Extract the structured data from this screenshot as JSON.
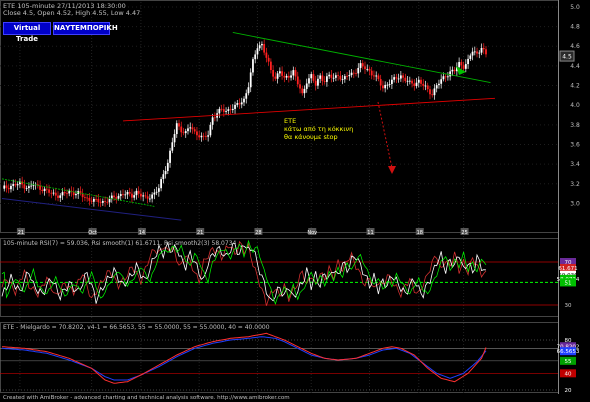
{
  "header": {
    "line1": "ETE  105-minute  27/11/2013 18:30:00",
    "line2": "Close 4.5, Open 4.52, High 4.55, Low 4.47"
  },
  "buttons": {
    "virtual_trade": "Virtual Trade",
    "broker": "ΝΑΥΤΕΜΠΟΡΙΚΗ"
  },
  "annotation": [
    "ETE",
    "κάτω από τη κόκκινη",
    "θα κάνουμε stop"
  ],
  "footer": "Created with AmiBroker - advanced charting and technical analysis software. http://www.amibroker.com",
  "colors": {
    "background": "#000000",
    "up_candle": "#ffffff",
    "down_candle": "#ff2020",
    "green_trend": "#00b000",
    "red_trend": "#e00000",
    "blue_trend": "#202080",
    "rsi": "#ffffff",
    "rsi_smooth": "#d03030",
    "rsi_smooth2": "#00ff00",
    "mg_line": "#ff3030",
    "mg_line2": "#2040ff",
    "annotation": "#ffff00"
  },
  "chart_data": [
    {
      "type": "candlestick",
      "title": "ETE 105-minute",
      "y_ticks": [
        5.0,
        4.8,
        4.6,
        4.4,
        4.2,
        4.0,
        3.8,
        3.6,
        3.4,
        3.2,
        3.0
      ],
      "ylim": [
        2.75,
        5.03
      ],
      "last_value": "4.5",
      "x_ticks": [
        "21",
        "Oct",
        "14",
        "21",
        "28",
        "Nov",
        "11",
        "18",
        "25"
      ],
      "close_path": [
        [
          0,
          3.15
        ],
        [
          4,
          3.18
        ],
        [
          8,
          3.2
        ],
        [
          12,
          3.16
        ],
        [
          14,
          3.19
        ],
        [
          18,
          3.15
        ],
        [
          22,
          3.1
        ],
        [
          26,
          3.08
        ],
        [
          30,
          3.12
        ],
        [
          34,
          3.1
        ],
        [
          38,
          3.05
        ],
        [
          42,
          3.02
        ],
        [
          46,
          3.02
        ],
        [
          50,
          3.06
        ],
        [
          54,
          3.1
        ],
        [
          58,
          3.08
        ],
        [
          60,
          3.12
        ],
        [
          62,
          3.08
        ],
        [
          64,
          3.05
        ],
        [
          68,
          3.1
        ],
        [
          70,
          3.15
        ],
        [
          72,
          3.3
        ],
        [
          74,
          3.42
        ],
        [
          76,
          3.62
        ],
        [
          78,
          3.8
        ],
        [
          80,
          3.75
        ],
        [
          82,
          3.72
        ],
        [
          84,
          3.78
        ],
        [
          86,
          3.72
        ],
        [
          88,
          3.7
        ],
        [
          90,
          3.66
        ],
        [
          92,
          3.7
        ],
        [
          94,
          3.88
        ],
        [
          96,
          3.92
        ],
        [
          98,
          3.95
        ],
        [
          100,
          3.94
        ],
        [
          102,
          3.97
        ],
        [
          104,
          3.98
        ],
        [
          106,
          4.02
        ],
        [
          108,
          4.06
        ],
        [
          110,
          4.2
        ],
        [
          112,
          4.44
        ],
        [
          114,
          4.6
        ],
        [
          116,
          4.62
        ],
        [
          118,
          4.48
        ],
        [
          120,
          4.35
        ],
        [
          122,
          4.28
        ],
        [
          124,
          4.35
        ],
        [
          126,
          4.26
        ],
        [
          128,
          4.3
        ],
        [
          130,
          4.35
        ],
        [
          132,
          4.22
        ],
        [
          134,
          4.1
        ],
        [
          136,
          4.25
        ],
        [
          138,
          4.3
        ],
        [
          140,
          4.2
        ],
        [
          142,
          4.3
        ],
        [
          144,
          4.25
        ],
        [
          146,
          4.3
        ],
        [
          148,
          4.27
        ],
        [
          150,
          4.32
        ],
        [
          152,
          4.25
        ],
        [
          154,
          4.3
        ],
        [
          156,
          4.32
        ],
        [
          158,
          4.35
        ],
        [
          160,
          4.4
        ],
        [
          162,
          4.38
        ],
        [
          164,
          4.35
        ],
        [
          166,
          4.3
        ],
        [
          168,
          4.25
        ],
        [
          170,
          4.18
        ],
        [
          172,
          4.22
        ],
        [
          174,
          4.24
        ],
        [
          176,
          4.28
        ],
        [
          178,
          4.3
        ],
        [
          180,
          4.26
        ],
        [
          182,
          4.22
        ],
        [
          184,
          4.22
        ],
        [
          186,
          4.25
        ],
        [
          188,
          4.2
        ],
        [
          190,
          4.15
        ],
        [
          192,
          4.12
        ],
        [
          194,
          4.2
        ],
        [
          196,
          4.25
        ],
        [
          198,
          4.3
        ],
        [
          200,
          4.34
        ],
        [
          202,
          4.35
        ],
        [
          204,
          4.42
        ],
        [
          206,
          4.4
        ],
        [
          208,
          4.45
        ],
        [
          210,
          4.55
        ],
        [
          212,
          4.52
        ],
        [
          214,
          4.6
        ],
        [
          216,
          4.5
        ]
      ],
      "trendlines": [
        {
          "color": "green",
          "from": [
            103,
            4.74
          ],
          "to": [
            218,
            4.23
          ]
        },
        {
          "color": "red",
          "from": [
            54,
            3.84
          ],
          "to": [
            220,
            4.07
          ]
        },
        {
          "color": "green",
          "from": [
            0,
            3.25
          ],
          "to": [
            68,
            2.97
          ]
        },
        {
          "color": "blue",
          "from": [
            0,
            3.05
          ],
          "to": [
            80,
            2.83
          ]
        }
      ]
    },
    {
      "type": "line",
      "title": "105-minute RSI(7) = 59.036, Rsi smooth(1) 61.6711, Rsi smooth2(3) 58.0734",
      "y_ticks": [
        70,
        51,
        30
      ],
      "right_labels": [
        "70",
        "61.671",
        "59.036",
        "58.0734",
        "51",
        "30"
      ],
      "series": [
        {
          "name": "RSI(7)",
          "last": 59.036
        },
        {
          "name": "Rsi smooth(1)",
          "last": 61.6711
        },
        {
          "name": "Rsi smooth2(3)",
          "last": 58.0734
        }
      ],
      "rsi_path": [
        [
          0,
          38
        ],
        [
          4,
          55
        ],
        [
          8,
          42
        ],
        [
          12,
          62
        ],
        [
          14,
          48
        ],
        [
          18,
          40
        ],
        [
          22,
          55
        ],
        [
          26,
          38
        ],
        [
          30,
          50
        ],
        [
          34,
          42
        ],
        [
          38,
          60
        ],
        [
          42,
          35
        ],
        [
          46,
          50
        ],
        [
          50,
          62
        ],
        [
          54,
          48
        ],
        [
          58,
          58
        ],
        [
          60,
          66
        ],
        [
          64,
          52
        ],
        [
          68,
          75
        ],
        [
          70,
          82
        ],
        [
          72,
          78
        ],
        [
          74,
          85
        ],
        [
          76,
          80
        ],
        [
          78,
          84
        ],
        [
          80,
          72
        ],
        [
          82,
          66
        ],
        [
          84,
          78
        ],
        [
          86,
          70
        ],
        [
          88,
          60
        ],
        [
          90,
          52
        ],
        [
          92,
          70
        ],
        [
          94,
          76
        ],
        [
          96,
          82
        ],
        [
          98,
          80
        ],
        [
          100,
          74
        ],
        [
          102,
          82
        ],
        [
          104,
          86
        ],
        [
          106,
          76
        ],
        [
          108,
          88
        ],
        [
          110,
          80
        ],
        [
          112,
          84
        ],
        [
          114,
          68
        ],
        [
          116,
          56
        ],
        [
          118,
          44
        ],
        [
          120,
          32
        ],
        [
          122,
          40
        ],
        [
          124,
          46
        ],
        [
          126,
          38
        ],
        [
          128,
          48
        ],
        [
          130,
          36
        ],
        [
          132,
          44
        ],
        [
          134,
          50
        ],
        [
          136,
          62
        ],
        [
          138,
          48
        ],
        [
          140,
          58
        ],
        [
          142,
          48
        ],
        [
          144,
          60
        ],
        [
          146,
          54
        ],
        [
          148,
          64
        ],
        [
          150,
          56
        ],
        [
          152,
          70
        ],
        [
          154,
          62
        ],
        [
          156,
          72
        ],
        [
          158,
          76
        ],
        [
          160,
          66
        ],
        [
          162,
          58
        ],
        [
          164,
          48
        ],
        [
          166,
          56
        ],
        [
          168,
          44
        ],
        [
          170,
          52
        ],
        [
          172,
          48
        ],
        [
          174,
          58
        ],
        [
          176,
          52
        ],
        [
          178,
          46
        ],
        [
          180,
          40
        ],
        [
          182,
          48
        ],
        [
          184,
          54
        ],
        [
          186,
          44
        ],
        [
          188,
          40
        ],
        [
          190,
          50
        ],
        [
          192,
          58
        ],
        [
          194,
          70
        ],
        [
          196,
          76
        ],
        [
          198,
          62
        ],
        [
          200,
          72
        ],
        [
          202,
          66
        ],
        [
          204,
          78
        ],
        [
          206,
          62
        ],
        [
          208,
          70
        ],
        [
          210,
          60
        ],
        [
          212,
          74
        ],
        [
          214,
          66
        ],
        [
          216,
          59
        ]
      ]
    },
    {
      "type": "line",
      "title": "ETE - Mielgardo = 70.8202, v4-1 = 66.5653, 55 = 55.0000, 55 = 55.0000, 40 = 40.0000",
      "y_ticks": [
        80,
        70,
        55,
        40,
        20
      ],
      "right_labels": [
        "80",
        "70.8202",
        "66.5653",
        "55",
        "40",
        "20"
      ],
      "series": [
        {
          "name": "Mielgardo",
          "last": 70.8202
        },
        {
          "name": "v4-1",
          "last": 66.5653
        }
      ],
      "mg_path": [
        [
          0,
          72
        ],
        [
          10,
          70
        ],
        [
          20,
          66
        ],
        [
          30,
          58
        ],
        [
          40,
          46
        ],
        [
          46,
          32
        ],
        [
          50,
          28
        ],
        [
          56,
          30
        ],
        [
          62,
          38
        ],
        [
          70,
          50
        ],
        [
          78,
          62
        ],
        [
          86,
          72
        ],
        [
          94,
          78
        ],
        [
          102,
          82
        ],
        [
          110,
          84
        ],
        [
          114,
          86
        ],
        [
          118,
          88
        ],
        [
          122,
          84
        ],
        [
          126,
          80
        ],
        [
          132,
          72
        ],
        [
          138,
          64
        ],
        [
          144,
          58
        ],
        [
          150,
          56
        ],
        [
          158,
          58
        ],
        [
          164,
          64
        ],
        [
          170,
          70
        ],
        [
          174,
          72
        ],
        [
          178,
          70
        ],
        [
          184,
          62
        ],
        [
          190,
          46
        ],
        [
          196,
          34
        ],
        [
          202,
          30
        ],
        [
          208,
          40
        ],
        [
          214,
          58
        ],
        [
          216,
          71
        ]
      ],
      "v4_path": [
        [
          0,
          70
        ],
        [
          10,
          68
        ],
        [
          20,
          64
        ],
        [
          30,
          56
        ],
        [
          40,
          46
        ],
        [
          46,
          36
        ],
        [
          50,
          32
        ],
        [
          56,
          32
        ],
        [
          62,
          38
        ],
        [
          70,
          48
        ],
        [
          78,
          60
        ],
        [
          86,
          70
        ],
        [
          94,
          76
        ],
        [
          102,
          80
        ],
        [
          110,
          82
        ],
        [
          116,
          84
        ],
        [
          122,
          82
        ],
        [
          126,
          78
        ],
        [
          132,
          70
        ],
        [
          138,
          62
        ],
        [
          144,
          58
        ],
        [
          150,
          56
        ],
        [
          158,
          58
        ],
        [
          164,
          62
        ],
        [
          170,
          68
        ],
        [
          176,
          70
        ],
        [
          182,
          64
        ],
        [
          188,
          52
        ],
        [
          194,
          40
        ],
        [
          200,
          34
        ],
        [
          206,
          40
        ],
        [
          212,
          54
        ],
        [
          216,
          67
        ]
      ]
    }
  ]
}
